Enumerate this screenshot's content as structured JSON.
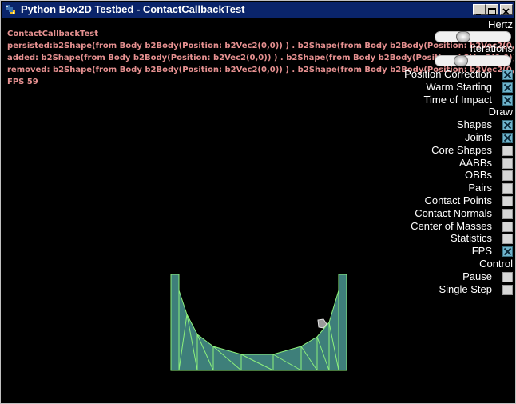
{
  "window": {
    "title": "Python Box2D Testbed - ContactCallbackTest",
    "buttons": [
      "minimize",
      "maximize",
      "close"
    ]
  },
  "info": {
    "test_name": "ContactCallbackTest",
    "persisted": "persisted:b2Shape(from Body b2Body(Position: b2Vec2(0,0)) ) . b2Shape(from Body b2Body(Position: b2Vec2(0,0)) ) . b",
    "added": "added:   b2Shape(from Body b2Body(Position: b2Vec2(0,0)) ) . b2Shape(from Body b2Body(Position: b2Vec2(0,0)) ) . b",
    "removed": "removed: b2Shape(from Body b2Body(Position: b2Vec2(0,0)) ) . b2Shape(from Body b2Body(Position: b2Vec2(0,0)) ) . b",
    "fps": "FPS 59"
  },
  "panel": {
    "hertz_label": "Hertz",
    "hertz_value_fraction": 0.33,
    "iterations_label": "Iterations",
    "iterations_value_fraction": 0.3,
    "settings": [
      {
        "label": "Position Correction",
        "checked": true
      },
      {
        "label": "Warm Starting",
        "checked": true
      },
      {
        "label": "Time of Impact",
        "checked": true
      }
    ],
    "draw_header": "Draw",
    "draw": [
      {
        "label": "Shapes",
        "checked": true
      },
      {
        "label": "Joints",
        "checked": true
      },
      {
        "label": "Core Shapes",
        "checked": false
      },
      {
        "label": "AABBs",
        "checked": false
      },
      {
        "label": "OBBs",
        "checked": false
      },
      {
        "label": "Pairs",
        "checked": false
      },
      {
        "label": "Contact Points",
        "checked": false
      },
      {
        "label": "Contact Normals",
        "checked": false
      },
      {
        "label": "Center of Masses",
        "checked": false
      },
      {
        "label": "Statistics",
        "checked": false
      },
      {
        "label": "FPS",
        "checked": true
      }
    ],
    "control_header": "Control",
    "control": [
      {
        "label": "Pause",
        "checked": false
      },
      {
        "label": "Single Step",
        "checked": false
      }
    ]
  },
  "colors": {
    "info_text": "#e59090",
    "shape_fill": "#3e7f7a",
    "shape_outline": "#8cf07c",
    "checkbox_on": "#6fb4cc"
  }
}
